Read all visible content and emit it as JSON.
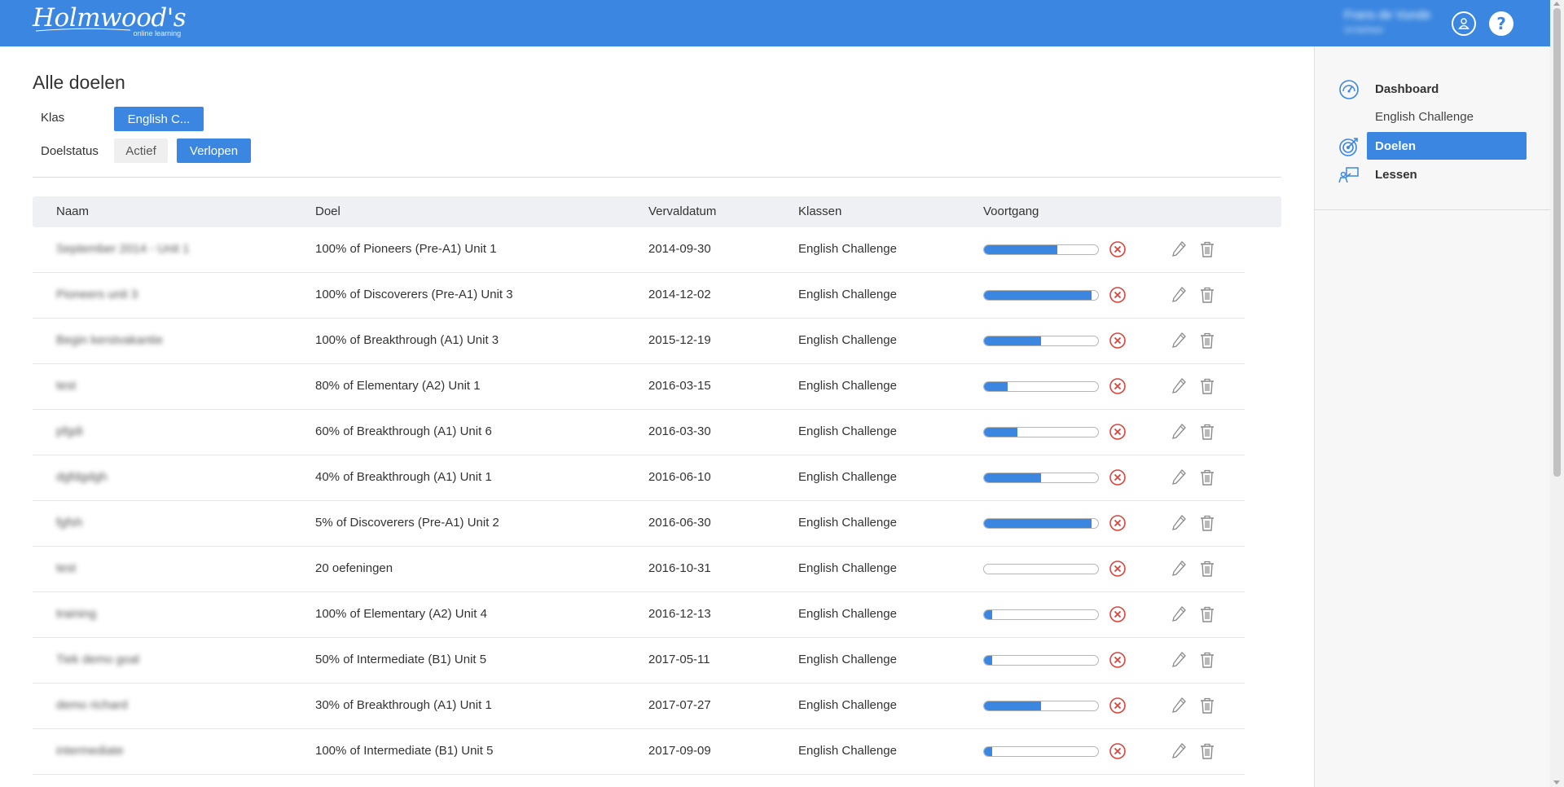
{
  "brand": {
    "logo_text": "Holmwood's",
    "logo_sub": "online learning",
    "primary_color": "#3a86e0"
  },
  "user": {
    "name": "Frans de Vunde",
    "role": "ict-beheer"
  },
  "header": {
    "help_label": "?"
  },
  "page": {
    "title": "Alle doelen"
  },
  "filters": {
    "klas_label": "Klas",
    "klas_value": "English C...",
    "status_label": "Doelstatus",
    "status_options": [
      "Actief",
      "Verlopen"
    ],
    "status_selected": "Verlopen"
  },
  "table": {
    "headers": [
      "Naam",
      "Doel",
      "Vervaldatum",
      "Klassen",
      "Voortgang"
    ],
    "rows": [
      {
        "naam": "September 2014 - Unit 1",
        "doel": "100% of Pioneers (Pre-A1) Unit 1",
        "datum": "2014-09-30",
        "klas": "English Challenge",
        "progress": 0.64
      },
      {
        "naam": "Pioneers unit 3",
        "doel": "100% of Discoverers (Pre-A1) Unit 3",
        "datum": "2014-12-02",
        "klas": "English Challenge",
        "progress": 0.94
      },
      {
        "naam": "Begin kerstvakantie",
        "doel": "100% of Breakthrough (A1) Unit 3",
        "datum": "2015-12-19",
        "klas": "English Challenge",
        "progress": 0.5
      },
      {
        "naam": "test",
        "doel": "80% of Elementary (A2) Unit 1",
        "datum": "2016-03-15",
        "klas": "English Challenge",
        "progress": 0.21
      },
      {
        "naam": "pfgdi",
        "doel": "60% of Breakthrough (A1) Unit 6",
        "datum": "2016-03-30",
        "klas": "English Challenge",
        "progress": 0.29
      },
      {
        "naam": "dgfdgdgh",
        "doel": "40% of Breakthrough (A1) Unit 1",
        "datum": "2016-06-10",
        "klas": "English Challenge",
        "progress": 0.5
      },
      {
        "naam": "fgfsh",
        "doel": "5% of Discoverers (Pre-A1) Unit 2",
        "datum": "2016-06-30",
        "klas": "English Challenge",
        "progress": 0.94
      },
      {
        "naam": "test",
        "doel": "20 oefeningen",
        "datum": "2016-10-31",
        "klas": "English Challenge",
        "progress": 0.0
      },
      {
        "naam": "training",
        "doel": "100% of Elementary (A2) Unit 4",
        "datum": "2016-12-13",
        "klas": "English Challenge",
        "progress": 0.07
      },
      {
        "naam": "Tiek demo goal",
        "doel": "50% of Intermediate (B1) Unit 5",
        "datum": "2017-05-11",
        "klas": "English Challenge",
        "progress": 0.07
      },
      {
        "naam": "demo richard",
        "doel": "30% of Breakthrough (A1) Unit 1",
        "datum": "2017-07-27",
        "klas": "English Challenge",
        "progress": 0.5
      },
      {
        "naam": "intermediate",
        "doel": "100% of Intermediate (B1) Unit 5",
        "datum": "2017-09-09",
        "klas": "English Challenge",
        "progress": 0.07
      }
    ]
  },
  "sidebar": {
    "items": [
      {
        "label": "Dashboard",
        "icon": "dashboard-gauge-icon",
        "active": false
      },
      {
        "label": "English Challenge",
        "sub": true
      },
      {
        "label": "Doelen",
        "icon": "target-icon",
        "active": true
      },
      {
        "label": "Lessen",
        "icon": "lesson-icon",
        "active": false
      }
    ]
  }
}
